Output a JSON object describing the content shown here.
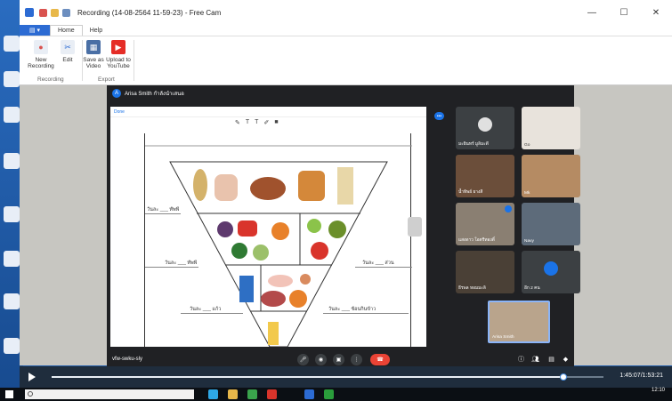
{
  "window": {
    "title": "Recording (14-08-2564 11-59-23) - Free Cam",
    "controls": [
      "—",
      "☐",
      "✕"
    ]
  },
  "ribbon": {
    "file_tab": "",
    "tabs": [
      "Home",
      "Help"
    ],
    "buttons": {
      "new_recording": "New\nRecording",
      "edit": "Edit",
      "save_as_video": "Save as\nVideo",
      "upload": "Upload to\nYouTube"
    },
    "groups": {
      "recording": "Recording",
      "export": "Export"
    }
  },
  "meet": {
    "presenter": "Arisa Smith กำลังนำเสนอ",
    "presenter_initial": "A",
    "meeting_code": "vfw-swku-sly",
    "doc_done": "Done",
    "self_name": "Arisa Smith",
    "participants": [
      {
        "name": "มะยินทร์ มูลิมะดี"
      },
      {
        "name": "Go"
      },
      {
        "name": "น้ำทิพย์ ยางสี"
      },
      {
        "name": "Mk"
      },
      {
        "name": "แสงดาว โอตรีทองดิ์"
      },
      {
        "name": "Navy"
      },
      {
        "name": "ธีรพล หอมมะลิ"
      },
      {
        "name": "อีก 2 คน"
      }
    ]
  },
  "worksheet": {
    "labels": [
      "วันละ ___ ทัพพี",
      "วันละ ___ ทัพพี",
      "วันละ ___ ส่วน",
      "วันละ ___ แก้ว",
      "วันละ ___ ช้อนกินข้าว"
    ]
  },
  "playback": {
    "time": "1:45:07/1:53:21",
    "progress_fraction": 0.927
  },
  "taskbar": {
    "clock": "12:10"
  },
  "colors": {
    "accent": "#2c6bd3",
    "meet_bg": "#202124",
    "hangup": "#ea4335",
    "meet_blue": "#1a73e8"
  }
}
